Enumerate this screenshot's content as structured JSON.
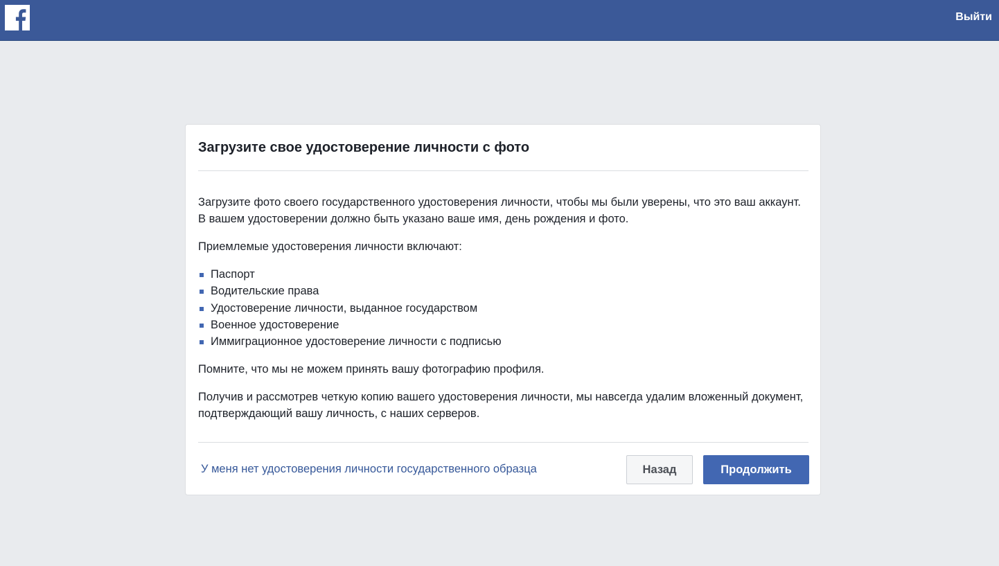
{
  "header": {
    "logo_icon": "facebook-f-icon",
    "logout_label": "Выйти",
    "bar_color": "#3b5998"
  },
  "dialog": {
    "title": "Загрузите свое удостоверение личности с фото",
    "intro": "Загрузите фото своего государственного удостоверения личности, чтобы мы были уверены, что это ваш аккаунт. В вашем удостоверении должно быть указано ваше имя, день рождения и фото.",
    "accepted_heading": "Приемлемые удостоверения личности включают:",
    "accepted_ids": [
      "Паспорт",
      "Водительские права",
      "Удостоверение личности, выданное государством",
      "Военное удостоверение",
      "Иммиграционное удостоверение личности с подписью"
    ],
    "note": "Помните, что мы не можем принять вашу фотографию профиля.",
    "deletion_notice": "Получив и рассмотрев четкую копию вашего удостоверения личности, мы навсегда удалим вложенный документ, подтверждающий вашу личность, с наших серверов.",
    "no_id_link": "У меня нет удостоверения личности государственного образца",
    "back_label": "Назад",
    "continue_label": "Продолжить",
    "accent_color": "#4267b2"
  }
}
